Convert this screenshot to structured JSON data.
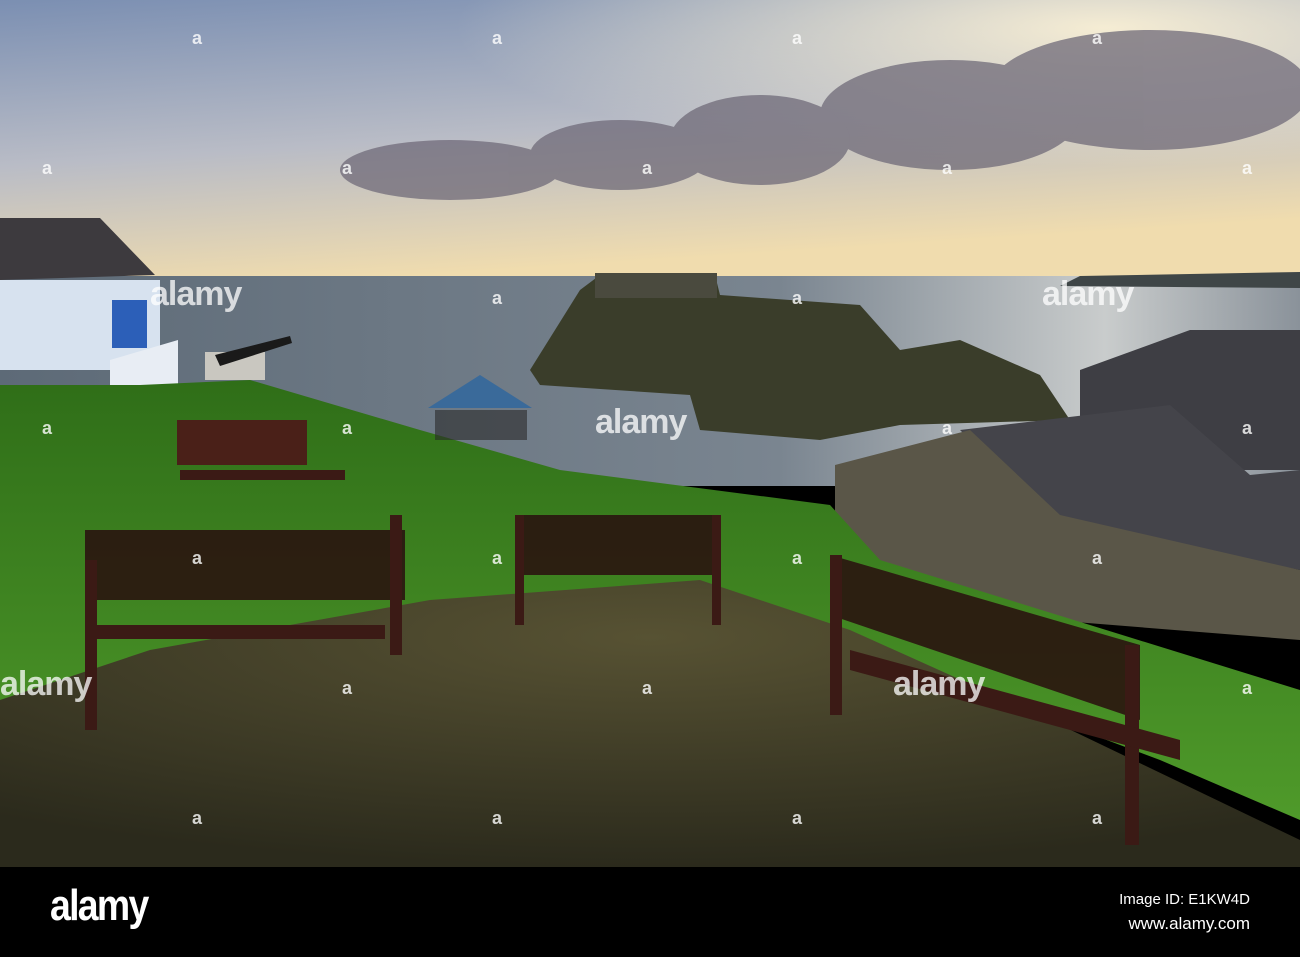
{
  "photo": {
    "subject": "benches",
    "colors": {
      "sky_top": "#7f93b4",
      "horizon": "#f1ddb0",
      "sea": "#6d7a86",
      "grass": "#3f8a22",
      "path": "#3a3a24",
      "bench": "#3a1a14"
    }
  },
  "watermark": {
    "text": "alamy",
    "mark": "a"
  },
  "footer": {
    "logo": "alamy",
    "image_id": "Image ID: E1KW4D",
    "url": "www.alamy.com"
  }
}
